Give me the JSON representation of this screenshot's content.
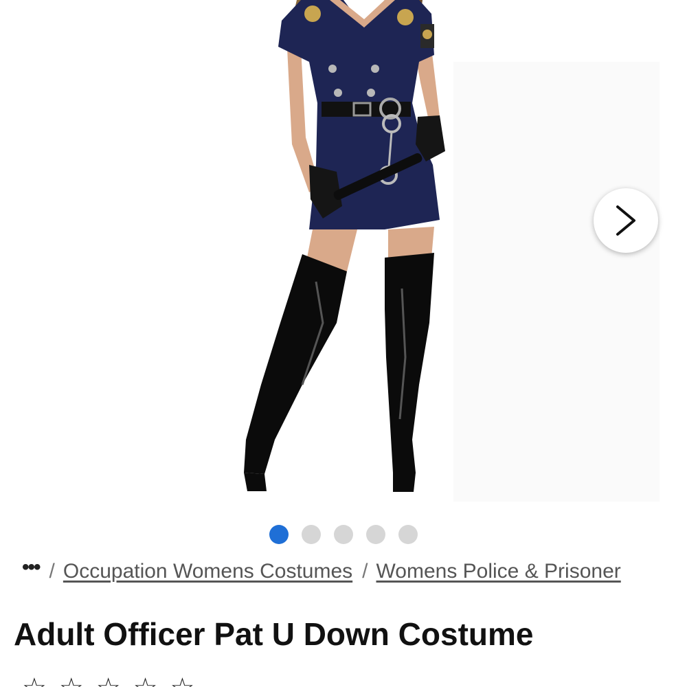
{
  "product": {
    "title": "Adult Officer Pat U Down Costume",
    "image_alt": "woman wearing navy police costume dress with belt, handcuffs, gloves, baton and black thigh-high boots"
  },
  "carousel": {
    "next_icon": "chevron-right-icon",
    "dot_count": 5,
    "active_index": 0,
    "active_color": "#1f6fd6",
    "inactive_color": "#d6d6d6"
  },
  "breadcrumb": {
    "more": "•••",
    "separator": "/",
    "items": [
      {
        "label": "Occupation Womens Costumes"
      },
      {
        "label": "Womens Police & Prisoner"
      }
    ]
  },
  "rating": {
    "icon": "star-icon",
    "stars": "☆☆☆☆☆"
  }
}
